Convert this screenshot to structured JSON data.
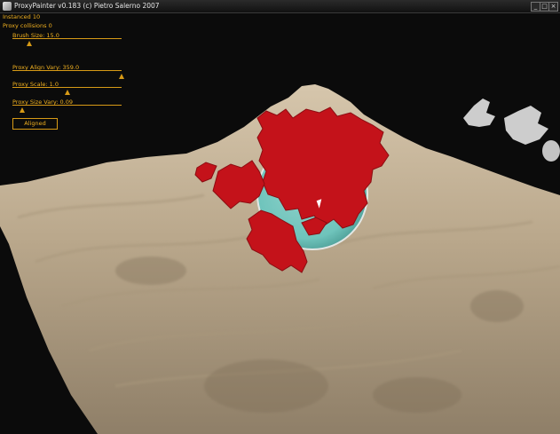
{
  "window": {
    "title": "ProxyPainter v0.183 (c) Pietro Salerno 2007",
    "controls": [
      "_",
      "□",
      "×"
    ]
  },
  "hud": {
    "instanced": "Instanced 10",
    "collisions": "Proxy collisions 0",
    "brush_size": "Brush Size: 15.0",
    "align_vary": "Proxy Align Vary: 359.0",
    "scale": "Proxy Scale: 1.0",
    "size_vary": "Proxy Size Vary: 0.09",
    "aligned_button": "Aligned"
  },
  "sliders": {
    "brush_size_level": 0.13,
    "align_vary_level": 0.99,
    "scale_level": 0.5,
    "size_vary_level": 0.09
  },
  "icons": {
    "app": "app-icon",
    "cursor": "mouse-pointer-icon"
  },
  "colors": {
    "terrain": "#bfae94",
    "background": "#0b0b0b",
    "hud_text": "#f0b020",
    "paint": "#c4121a",
    "brush_sphere": "#67c7c1"
  }
}
